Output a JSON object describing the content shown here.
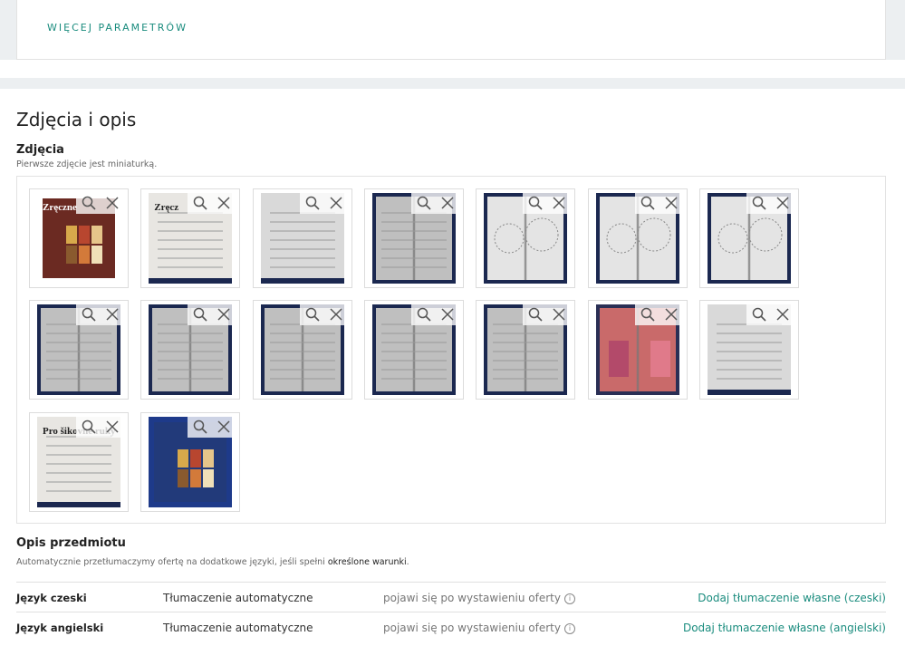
{
  "top": {
    "more_params_label": "WIĘCEJ PARAMETRÓW"
  },
  "section": {
    "title": "Zdjęcia i opis",
    "photos_title": "Zdjęcia",
    "photos_hint": "Pierwsze zdjęcie jest miniaturką."
  },
  "photos": [
    {
      "kind": "cover",
      "text": "Zręczne"
    },
    {
      "kind": "page",
      "text": "Zręcz"
    },
    {
      "kind": "text"
    },
    {
      "kind": "pattern"
    },
    {
      "kind": "doily"
    },
    {
      "kind": "doily"
    },
    {
      "kind": "doily"
    },
    {
      "kind": "pattern"
    },
    {
      "kind": "pattern"
    },
    {
      "kind": "pattern"
    },
    {
      "kind": "pattern"
    },
    {
      "kind": "pattern"
    },
    {
      "kind": "people"
    },
    {
      "kind": "text"
    },
    {
      "kind": "page",
      "text": "Pro šikovné ruky"
    },
    {
      "kind": "back"
    }
  ],
  "description": {
    "title": "Opis przedmiotu",
    "hint_prefix": "Automatycznie przetłumaczymy ofertę na dodatkowe języki, jeśli spełni ",
    "hint_link": "określone warunki",
    "hint_suffix": ".",
    "languages": [
      {
        "name": "Język czeski",
        "mode": "Tłumaczenie automatyczne",
        "status": "pojawi się po wystawieniu oferty",
        "action": "Dodaj tłumaczenie własne (czeski)"
      },
      {
        "name": "Język angielski",
        "mode": "Tłumaczenie automatyczne",
        "status": "pojawi się po wystawieniu oferty",
        "action": "Dodaj tłumaczenie własne (angielski)"
      }
    ]
  },
  "colors": {
    "accent": "#1a8c7e",
    "page_bg": "#eceff1"
  }
}
